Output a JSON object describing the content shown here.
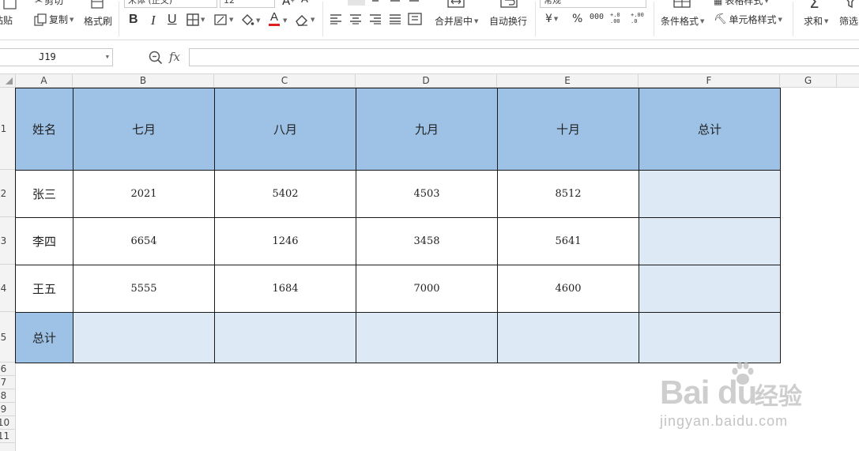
{
  "ribbon": {
    "cut": "剪切",
    "paste": "粘贴",
    "copy": "复制",
    "format_painter": "格式刷",
    "font_name": "宋体 (正文)",
    "font_size": "12",
    "bold": "B",
    "italic": "I",
    "underline": "U",
    "font_color_glyph": "A",
    "merge_center": "合并居中",
    "wrap_text": "自动换行",
    "number_format": "常规",
    "currency": "¥",
    "percent": "%",
    "thousands": "000",
    "dec_increase": "+.0 .00",
    "dec_decrease": "+.00 .0",
    "conditional_format": "条件格式",
    "table_style": "表格样式",
    "cell_style": "单元格样式",
    "sum": "求和",
    "filter": "筛选",
    "accent_red": "#e02020"
  },
  "formula_bar": {
    "cell_ref": "J19",
    "fx_label": "fx",
    "formula": ""
  },
  "sheet": {
    "columns": [
      "A",
      "B",
      "C",
      "D",
      "E",
      "F",
      "G"
    ],
    "rows": [
      "1",
      "2",
      "3",
      "4",
      "5",
      "6",
      "7",
      "8",
      "9",
      "10",
      "11"
    ],
    "header_fill": "#9dc2e6",
    "total_fill": "#ddeaf6",
    "table": {
      "headers": [
        "姓名",
        "七月",
        "八月",
        "九月",
        "十月",
        "总计"
      ],
      "rows": [
        {
          "name": "张三",
          "values": [
            "2021",
            "5402",
            "4503",
            "8512"
          ],
          "total": ""
        },
        {
          "name": "李四",
          "values": [
            "6654",
            "1246",
            "3458",
            "5641"
          ],
          "total": ""
        },
        {
          "name": "王五",
          "values": [
            "5555",
            "1684",
            "7000",
            "4600"
          ],
          "total": ""
        }
      ],
      "total_row": {
        "label": "总计",
        "values": [
          "",
          "",
          "",
          "",
          ""
        ]
      }
    }
  },
  "watermark": {
    "logo": "Bai du",
    "cn": "经验",
    "url": "jingyan.baidu.com"
  }
}
